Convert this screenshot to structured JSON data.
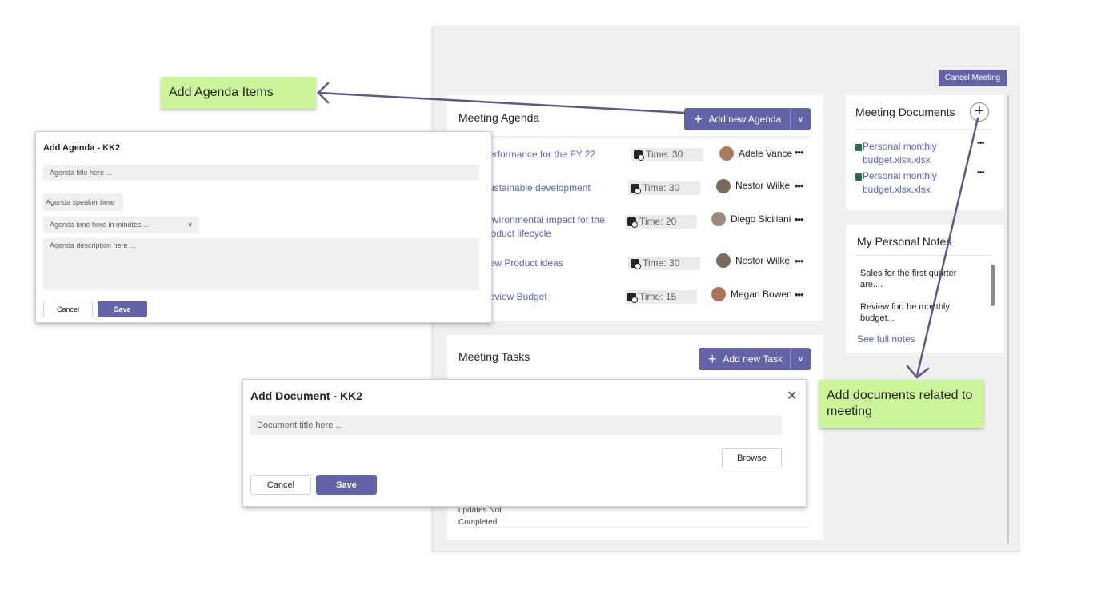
{
  "cancel_meeting_label": "Cancel Meeting",
  "agenda": {
    "title": "Meeting Agenda",
    "add_button": "Add new Agenda",
    "items": [
      {
        "title": "Performance for the FY 22",
        "time": "Time: 30",
        "person": "Adele Vance"
      },
      {
        "title": "Sustainable development",
        "time": "Time: 30",
        "person": "Nestor Wilke"
      },
      {
        "title": "Environmental impact for the product lifecycle",
        "time": "Time: 20",
        "person": "Diego Siciliani"
      },
      {
        "title": "New Product ideas",
        "time": "Time: 30",
        "person": "Nestor Wilke"
      },
      {
        "title": "Review Budget",
        "time": "Time: 15",
        "person": "Megan Bowen"
      }
    ]
  },
  "documents": {
    "title": "Meeting Documents",
    "items": [
      {
        "name": "Personal monthly budget.xlsx.xlsx"
      },
      {
        "name": "Personal monthly budget.xlsx.xlsx"
      }
    ]
  },
  "notes": {
    "title": "My Personal Notes",
    "items": [
      "Sales for the first quarter are....",
      "Review fort he monthly budget..."
    ],
    "see_full": "See full notes"
  },
  "tasks": {
    "title": "Meeting Tasks",
    "add_button": "Add new Task",
    "partial_status": "updates Not Completed"
  },
  "add_agenda_dialog": {
    "title": "Add Agenda - KK2",
    "title_placeholder": "Agenda title here ...",
    "speaker_placeholder": "Agenda speaker here",
    "time_placeholder": "Agenda time here in minutes ...",
    "description_placeholder": "Agenda description here ...",
    "cancel": "Cancel",
    "save": "Save"
  },
  "add_document_dialog": {
    "title": "Add Document - KK2",
    "title_placeholder": "Document title here ...",
    "browse": "Browse",
    "cancel": "Cancel",
    "save": "Save"
  },
  "callouts": {
    "agenda": "Add Agenda Items",
    "documents": "Add documents related to meeting"
  },
  "colors": {
    "accent": "#6264a7",
    "link": "#5b5fc7",
    "callout": "#ccf59a"
  }
}
